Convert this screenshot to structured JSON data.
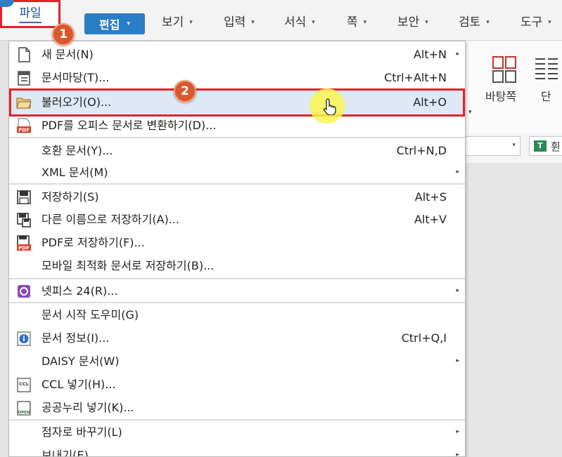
{
  "menubar": {
    "file": "파일",
    "edit": "편집",
    "items": [
      "보기",
      "입력",
      "서식",
      "쪽",
      "보안",
      "검토",
      "도구"
    ]
  },
  "ribbon": {
    "layout_label": "바탕쪽",
    "columns_label": "단",
    "font_preview": "휜",
    "font_icon": "T"
  },
  "menu": {
    "items": [
      {
        "label": "새 문서(N)",
        "shortcut": "Alt+N",
        "submenu": true,
        "icon": "new-document-icon"
      },
      {
        "label": "문서마당(T)...",
        "shortcut": "Ctrl+Alt+N",
        "submenu": false,
        "icon": "template-icon"
      },
      {
        "label": "불러오기(O)...",
        "shortcut": "Alt+O",
        "submenu": false,
        "icon": "open-folder-icon"
      },
      {
        "label": "PDF를 오피스 문서로 변환하기(D)...",
        "shortcut": "",
        "submenu": false,
        "icon": "pdf-convert-icon"
      },
      {
        "label": "호환 문서(Y)...",
        "shortcut": "Ctrl+N,D",
        "submenu": false,
        "icon": ""
      },
      {
        "label": "XML 문서(M)",
        "shortcut": "",
        "submenu": true,
        "icon": ""
      },
      {
        "label": "저장하기(S)",
        "shortcut": "Alt+S",
        "submenu": false,
        "icon": "save-icon"
      },
      {
        "label": "다른 이름으로 저장하기(A)...",
        "shortcut": "Alt+V",
        "submenu": false,
        "icon": "save-as-icon"
      },
      {
        "label": "PDF로 저장하기(F)...",
        "shortcut": "",
        "submenu": false,
        "icon": "save-pdf-icon"
      },
      {
        "label": "모바일 최적화 문서로 저장하기(B)...",
        "shortcut": "",
        "submenu": false,
        "icon": ""
      },
      {
        "label": "넷피스 24(R)...",
        "shortcut": "",
        "submenu": true,
        "icon": "netffice-icon"
      },
      {
        "label": "문서 시작 도우미(G)",
        "shortcut": "",
        "submenu": false,
        "icon": ""
      },
      {
        "label": "문서 정보(I)...",
        "shortcut": "Ctrl+Q,I",
        "submenu": false,
        "icon": "info-icon"
      },
      {
        "label": "DAISY 문서(W)",
        "shortcut": "",
        "submenu": true,
        "icon": ""
      },
      {
        "label": "CCL 넣기(H)...",
        "shortcut": "",
        "submenu": false,
        "icon": "ccl-icon"
      },
      {
        "label": "공공누리 넣기(K)...",
        "shortcut": "",
        "submenu": false,
        "icon": "kogl-icon"
      },
      {
        "label": "점자로 바꾸기(L)",
        "shortcut": "",
        "submenu": true,
        "icon": ""
      },
      {
        "label": "보내기(E)",
        "shortcut": "",
        "submenu": true,
        "icon": ""
      }
    ]
  },
  "badges": {
    "step1": "1",
    "step2": "2"
  },
  "colors": {
    "highlight_red": "#e0232b",
    "badge": "#d9582e",
    "selected_row": "#dfe8f5",
    "edit_button": "#2a7dc6"
  },
  "glyphs": {
    "submenu_arrow": "▸",
    "dropdown_arrow": "▾",
    "ccl": "CCL",
    "pdf": "PDF",
    "kogl": "OPEN"
  }
}
